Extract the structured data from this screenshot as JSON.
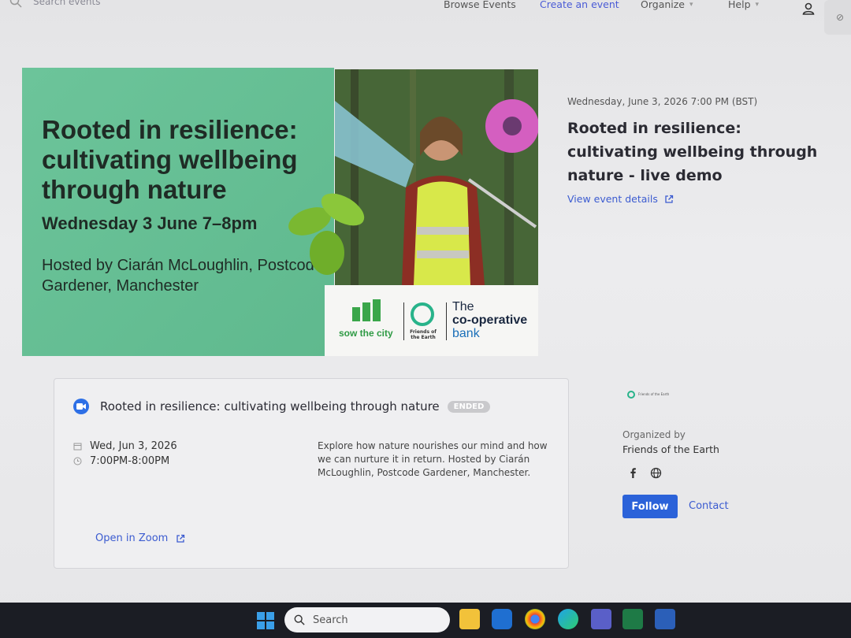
{
  "topbar": {
    "search_placeholder": "Search events",
    "browse": "Browse Events",
    "create": "Create an event",
    "organize": "Organize",
    "help": "Help"
  },
  "banner": {
    "title": "Rooted in resilience: cultivating wellbeing through nature",
    "date": "Wednesday 3 June 7–8pm",
    "host": "Hosted by Ciarán McLoughlin, Postcode Gardener, Manchester",
    "logo_sowthecity": "sow the city",
    "logo_foe": "Friends of the Earth",
    "logo_coop_the": "The",
    "logo_coop_name": "co-operative",
    "logo_coop_bank": "bank"
  },
  "event": {
    "datetime": "Wednesday, June 3, 2026 7:00 PM (BST)",
    "title": "Rooted in resilience: cultivating wellbeing through nature - live demo",
    "view_details": "View event details"
  },
  "card": {
    "title": "Rooted in resilience: cultivating wellbeing through nature",
    "status": "ENDED",
    "date": "Wed, Jun 3, 2026",
    "time": "7:00PM-8:00PM",
    "description": "Explore how nature nourishes our mind and how we can nurture it in return. Hosted by Ciarán McLoughlin, Postcode Gardener, Manchester.",
    "open_zoom": "Open in Zoom"
  },
  "organizer": {
    "label": "Organized by",
    "name": "Friends of the Earth",
    "follow": "Follow",
    "contact": "Contact"
  },
  "taskbar": {
    "search": "Search"
  },
  "colors": {
    "accent": "#2b62d9",
    "banner_green": "#6cc49a"
  }
}
